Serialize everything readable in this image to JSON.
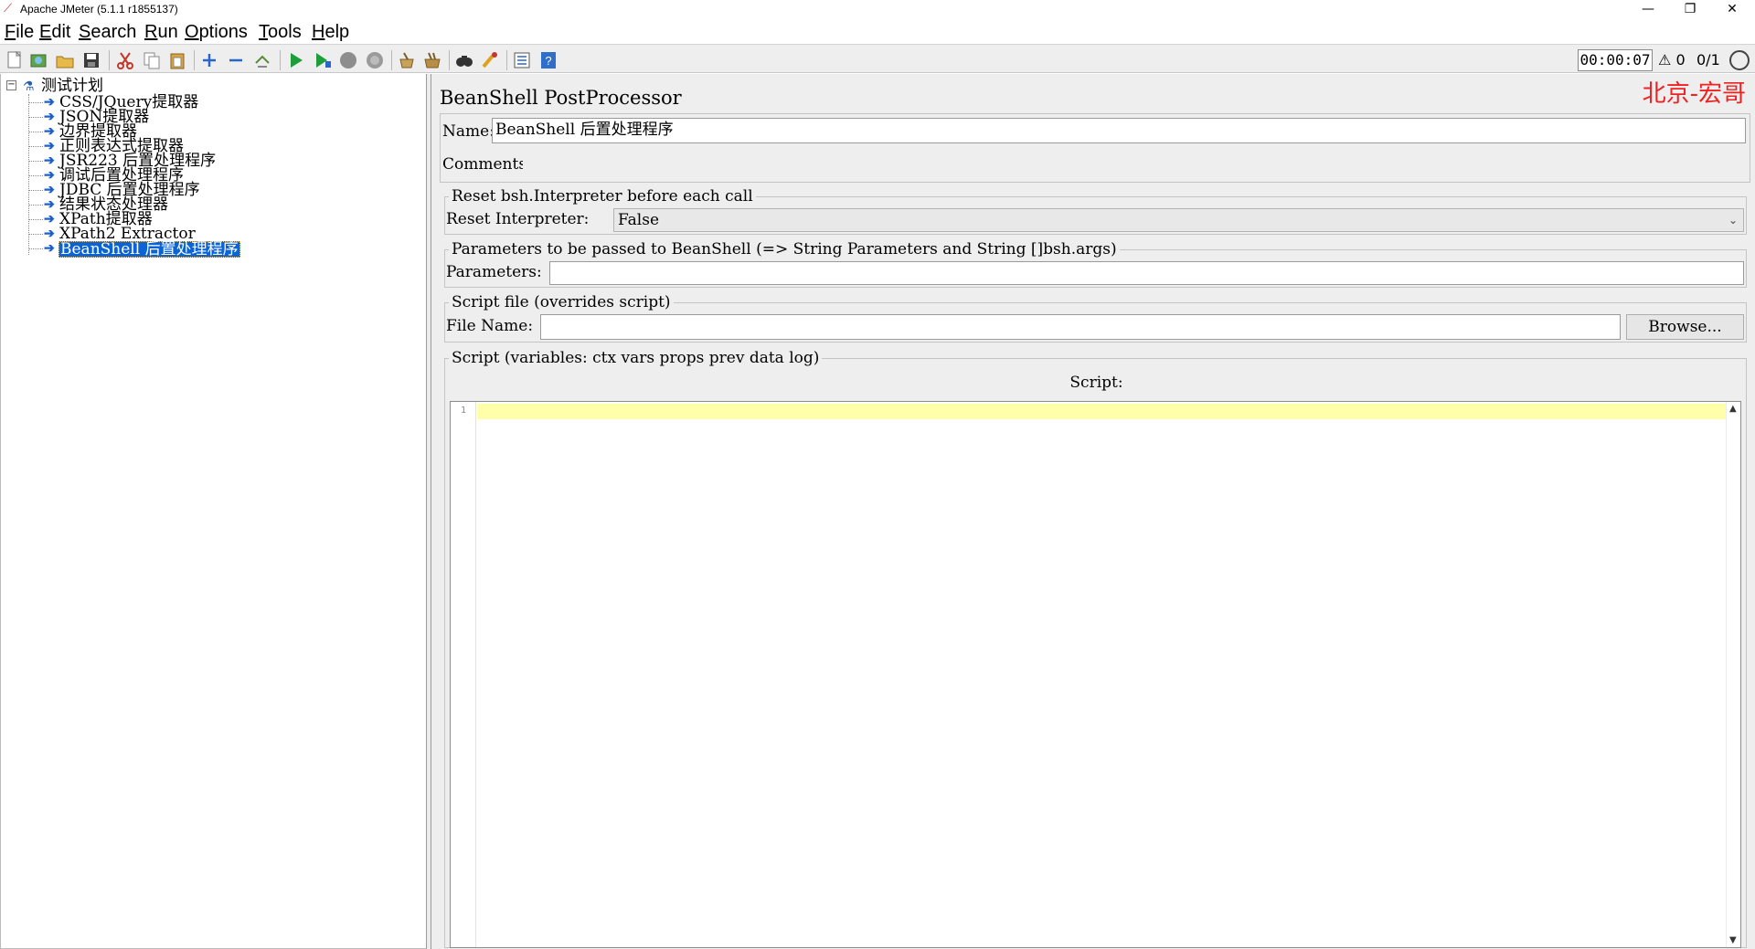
{
  "window": {
    "title": "Apache JMeter (5.1.1 r1855137)",
    "minimize": "—",
    "restore": "❐",
    "close": "✕"
  },
  "menu": [
    {
      "label": "File",
      "mnemonic": "F",
      "rest": "ile"
    },
    {
      "label": "Edit",
      "mnemonic": "E",
      "rest": "dit"
    },
    {
      "label": "Search",
      "mnemonic": "S",
      "rest": "earch"
    },
    {
      "label": "Run",
      "mnemonic": "R",
      "rest": "un"
    },
    {
      "label": "Options",
      "mnemonic": "O",
      "rest": "ptions"
    },
    {
      "label": "Tools",
      "mnemonic": "T",
      "rest": "ools"
    },
    {
      "label": "Help",
      "mnemonic": "H",
      "rest": "elp"
    }
  ],
  "toolbar": {
    "icons": [
      "new-icon",
      "templates-icon",
      "open-icon",
      "save-icon",
      "cut-icon",
      "copy-icon",
      "paste-icon",
      "expand-icon",
      "collapse-icon",
      "toggle-icon",
      "start-icon",
      "start-no-pauses-icon",
      "stop-icon",
      "shutdown-icon",
      "clear-icon",
      "clear-all-icon",
      "search-icon",
      "reset-search-icon",
      "function-helper-icon",
      "help-icon"
    ],
    "timer": "00:00:07",
    "warnings": "0",
    "threads": "0/1"
  },
  "tree": {
    "root": "测试计划",
    "items": [
      "CSS/JQuery提取器",
      "JSON提取器",
      "边界提取器",
      "正则表达式提取器",
      "JSR223 后置处理程序",
      "调试后置处理程序",
      "JDBC 后置处理程序",
      "结果状态处理器",
      "XPath提取器",
      "XPath2 Extractor",
      "BeanShell 后置处理程序"
    ],
    "selected_index": 10
  },
  "panel": {
    "title": "BeanShell PostProcessor",
    "watermark": "北京-宏哥",
    "name_label": "Name:",
    "name_value": "BeanShell 后置处理程序",
    "comments_label": "Comments:",
    "comments_value": "",
    "reset_group": "Reset bsh.Interpreter before each call",
    "reset_label": "Reset Interpreter:",
    "reset_value": "False",
    "params_group": "Parameters to be passed to BeanShell (=> String Parameters and String []bsh.args)",
    "params_label": "Parameters:",
    "params_value": "",
    "file_group": "Script file (overrides script)",
    "file_label": "File Name:",
    "file_value": "",
    "browse_label": "Browse...",
    "script_group": "Script (variables: ctx vars props prev data log)",
    "script_label": "Script:",
    "script_line_number": "1"
  },
  "colors": {
    "selection": "#0a64d6",
    "editor_current_line": "#ffffaa",
    "watermark": "#ee2222"
  }
}
